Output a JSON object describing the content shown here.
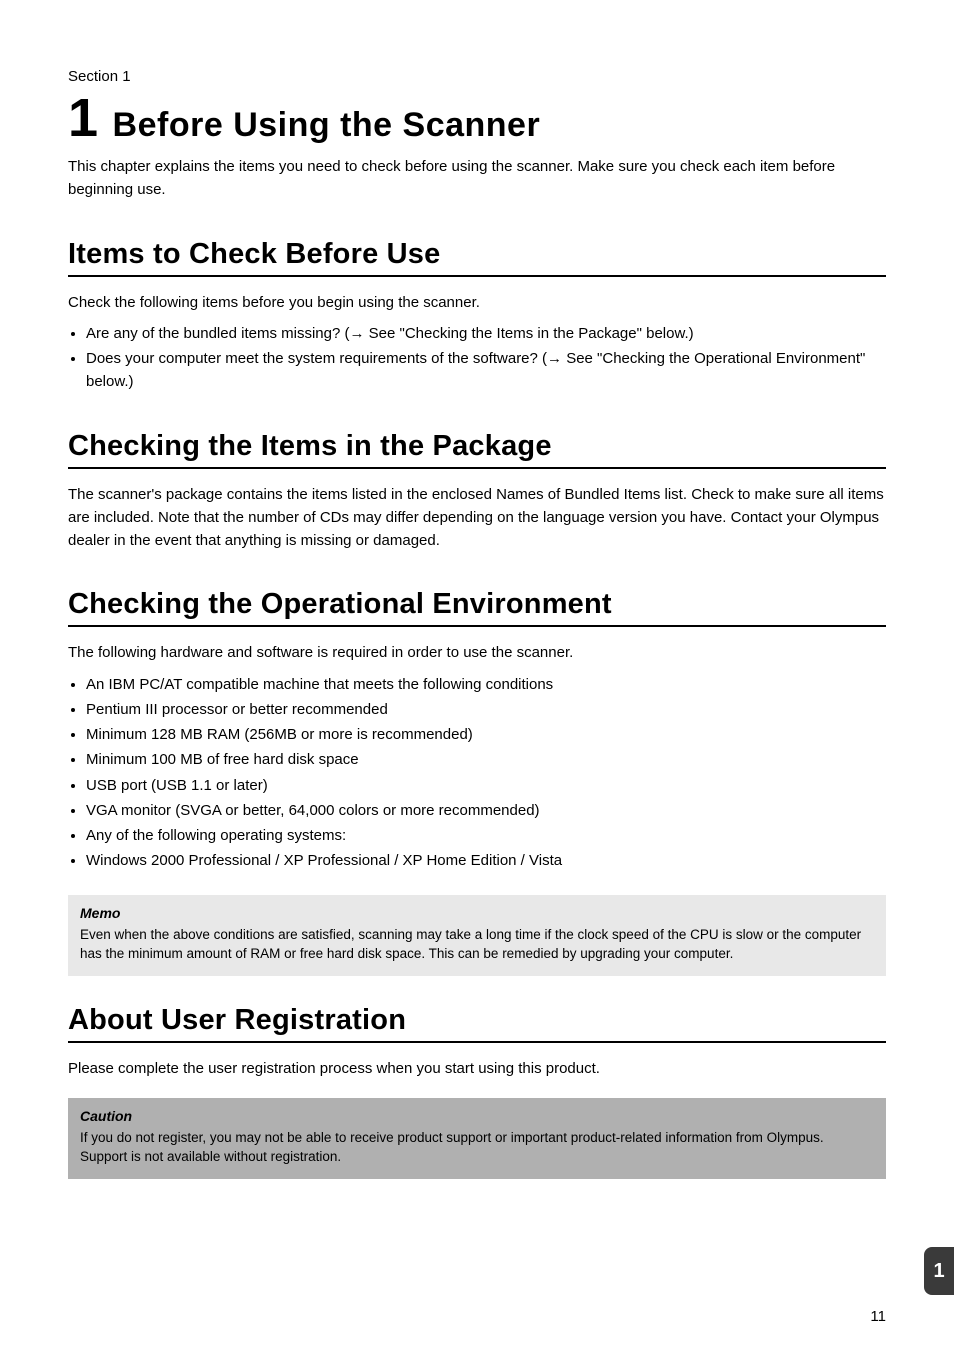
{
  "header": {
    "section_label": "Section 1",
    "chapter_num": "1",
    "chapter_title": "Before Using the Scanner",
    "intro": "This chapter explains the items you need to check before using the scanner. Make sure you check each item before beginning use."
  },
  "check_items": {
    "heading": "Items to Check Before Use",
    "body": "Check the following items before you begin using the scanner.",
    "bullets": [
      "Are any of the bundled items missing? (→ See \"Checking the Items in the Package\" below.)",
      "Does your computer meet the system requirements of the software? (→ See \"Checking the Operational Environment\" below.)"
    ]
  },
  "package": {
    "heading": "Checking the Items in the Package",
    "body": "The scanner's package contains the items listed in the enclosed Names of Bundled Items list. Check to make sure all items are included. Note that the number of CDs may differ depending on the language version you have. Contact your Olympus dealer in the event that anything is missing or damaged."
  },
  "operational_env": {
    "heading": "Checking the Operational Environment",
    "body1": "The following hardware and software is required in order to use the scanner.",
    "bullets": [
      "An IBM PC/AT compatible machine that meets the following conditions",
      "Pentium III processor or better recommended",
      "Minimum 128 MB RAM (256MB or more is recommended)",
      "Minimum 100 MB of free hard disk space",
      "USB port (USB 1.1 or later)",
      "VGA monitor (SVGA or better, 64,000 colors or more recommended)",
      "Any of the following operating systems:",
      "Windows 2000 Professional / XP Professional / XP Home Edition / Vista"
    ],
    "memo_label": "Memo",
    "memo_text": "Even when the above conditions are satisfied, scanning may take a long time if the clock speed of the CPU is slow or the computer has the minimum amount of RAM or free hard disk space. This can be remedied by upgrading your computer."
  },
  "user_reg": {
    "heading": "About User Registration",
    "body": "Please complete the user registration process when you start using this product.",
    "caution_label": "Caution",
    "caution_text": "If you do not register, you may not be able to receive product support or important product-related information from Olympus. Support is not available without registration."
  },
  "side_tab": "1",
  "page_num": "11"
}
